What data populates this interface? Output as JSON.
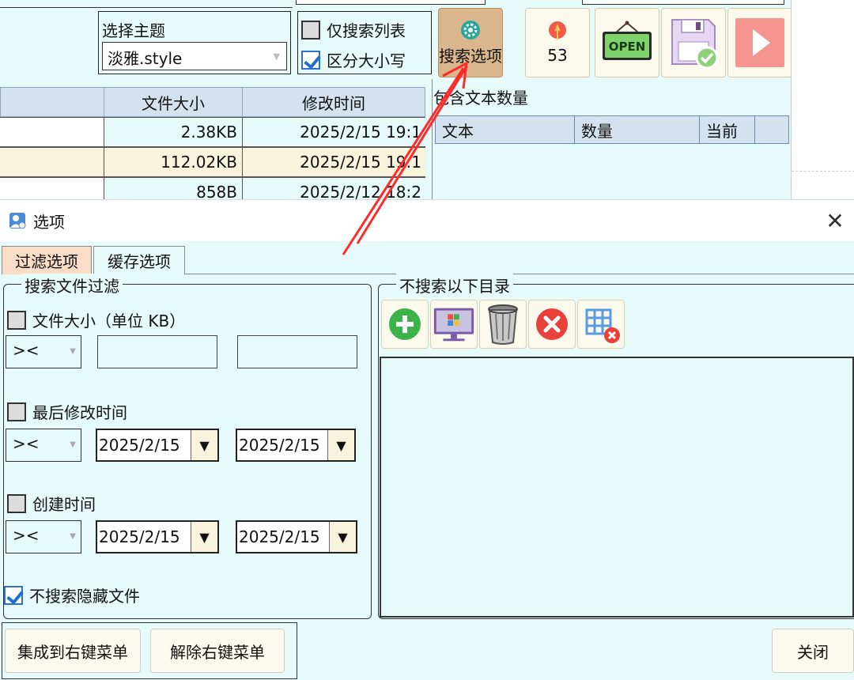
{
  "main": {
    "theme": {
      "label": "选择主题",
      "value": "淡雅.style"
    },
    "options": {
      "list_only": {
        "label": "仅搜索列表",
        "checked": false
      },
      "case_sensitive": {
        "label": "区分大小写",
        "checked": true
      }
    },
    "toolbar": {
      "search_options": "搜索选项",
      "count": "53"
    },
    "file_table": {
      "columns": [
        "文件大小",
        "修改时间"
      ],
      "rows": [
        {
          "size": "2.38KB",
          "mtime": "2025/2/15 19:1"
        },
        {
          "size": "112.02KB",
          "mtime": "2025/2/15 19:1"
        },
        {
          "size": "858B",
          "mtime": "2025/2/12 18:2"
        }
      ]
    },
    "count_panel": {
      "title": "包含文本数量",
      "columns": [
        "文本",
        "数量",
        "当前"
      ]
    }
  },
  "dialog": {
    "title": "选项",
    "close_glyph": "✕",
    "tabs": [
      {
        "label": "过滤选项",
        "active": true
      },
      {
        "label": "缓存选项",
        "active": false
      }
    ],
    "filter_group": {
      "legend": "搜索文件过滤",
      "file_size": {
        "label": "文件大小（单位 KB）",
        "checked": false,
        "operator": "><"
      },
      "modified": {
        "label": "最后修改时间",
        "checked": false,
        "operator": "><",
        "from": "2025/2/15",
        "to": "2025/2/15"
      },
      "created": {
        "label": "创建时间",
        "checked": false,
        "operator": "><",
        "from": "2025/2/15",
        "to": "2025/2/15"
      },
      "skip_hidden": {
        "label": "不搜索隐藏文件",
        "checked": true
      }
    },
    "exclude_group": {
      "legend": "不搜索以下目录"
    },
    "buttons": {
      "integrate": "集成到右键菜单",
      "remove": "解除右键菜单",
      "close": "关闭"
    }
  },
  "colors": {
    "bg": "#e6fafa",
    "active_tab": "#fbdcc7",
    "active_tool": "#d9b68c",
    "arrow": "#ff2a2a"
  }
}
